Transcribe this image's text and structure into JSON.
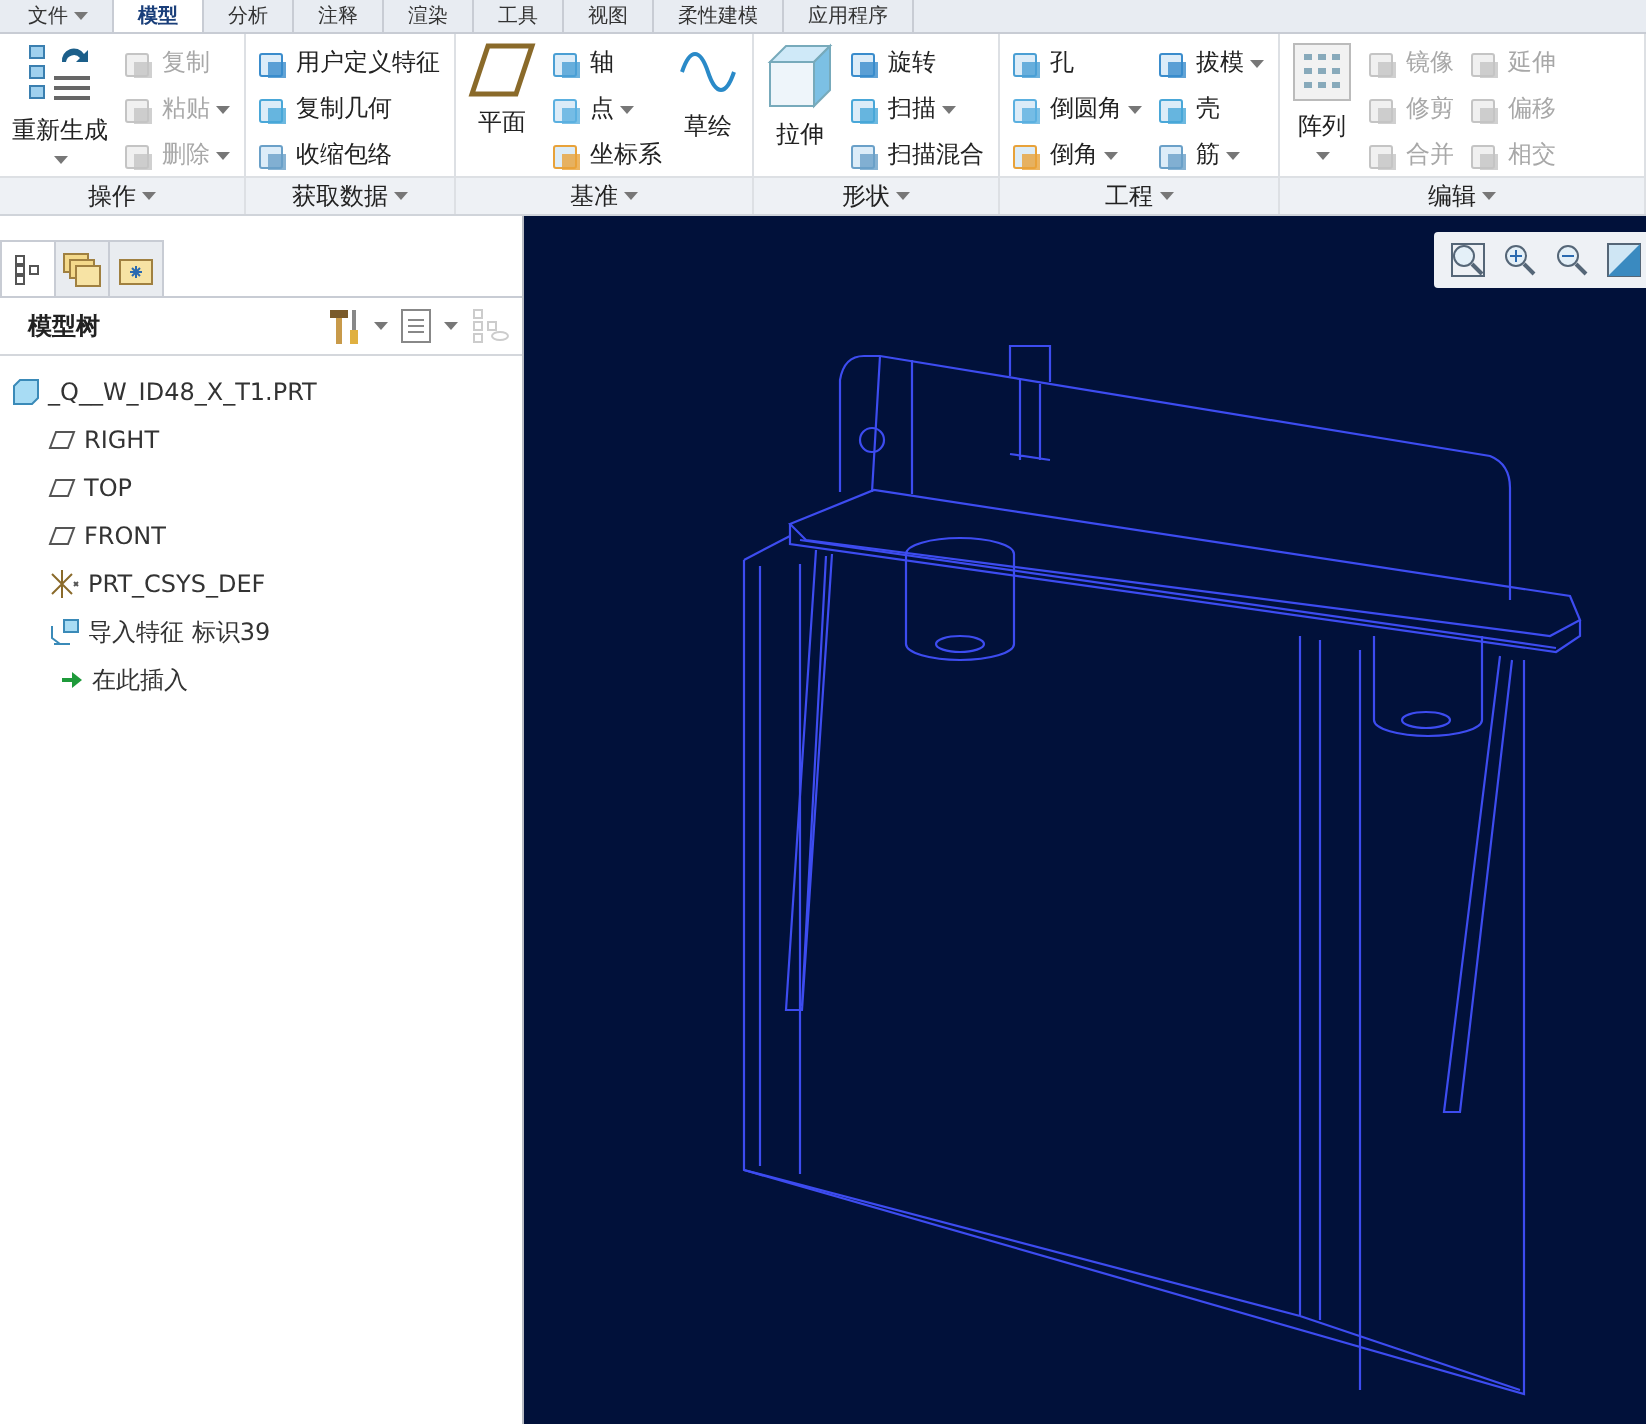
{
  "menu_tabs": [
    {
      "label": "文件",
      "dropdown": true,
      "selected": false
    },
    {
      "label": "模型",
      "dropdown": false,
      "selected": true
    },
    {
      "label": "分析",
      "dropdown": false,
      "selected": false
    },
    {
      "label": "注释",
      "dropdown": false,
      "selected": false
    },
    {
      "label": "渲染",
      "dropdown": false,
      "selected": false
    },
    {
      "label": "工具",
      "dropdown": false,
      "selected": false
    },
    {
      "label": "视图",
      "dropdown": false,
      "selected": false
    },
    {
      "label": "柔性建模",
      "dropdown": false,
      "selected": false
    },
    {
      "label": "应用程序",
      "dropdown": false,
      "selected": false
    }
  ],
  "ribbon": {
    "groups": [
      {
        "label": "操作",
        "columns": [
          [
            {
              "label": "重新生成",
              "kind": "large",
              "disabled": false,
              "dropdown": true
            }
          ],
          [
            {
              "label": "复制",
              "kind": "small",
              "disabled": true,
              "dropdown": false
            },
            {
              "label": "粘贴",
              "kind": "small",
              "disabled": true,
              "dropdown": true
            },
            {
              "label": "删除",
              "kind": "small",
              "disabled": true,
              "dropdown": true
            }
          ]
        ]
      },
      {
        "label": "获取数据",
        "columns": [
          [
            {
              "label": "用户定义特征",
              "kind": "small",
              "disabled": false,
              "dropdown": false
            },
            {
              "label": "复制几何",
              "kind": "small",
              "disabled": false,
              "dropdown": false
            },
            {
              "label": "收缩包络",
              "kind": "small",
              "disabled": false,
              "dropdown": false
            }
          ]
        ]
      },
      {
        "label": "基准",
        "columns": [
          [
            {
              "label": "平面",
              "kind": "large",
              "disabled": false,
              "dropdown": false
            }
          ],
          [
            {
              "label": "轴",
              "kind": "small",
              "disabled": false,
              "dropdown": false
            },
            {
              "label": "点",
              "kind": "small",
              "disabled": false,
              "dropdown": true
            },
            {
              "label": "坐标系",
              "kind": "small",
              "disabled": false,
              "dropdown": false
            }
          ],
          [
            {
              "label": "草绘",
              "kind": "large",
              "disabled": false,
              "dropdown": false
            }
          ]
        ]
      },
      {
        "label": "形状",
        "columns": [
          [
            {
              "label": "拉伸",
              "kind": "large",
              "disabled": false,
              "dropdown": false
            }
          ],
          [
            {
              "label": "旋转",
              "kind": "small",
              "disabled": false,
              "dropdown": false
            },
            {
              "label": "扫描",
              "kind": "small",
              "disabled": false,
              "dropdown": true
            },
            {
              "label": "扫描混合",
              "kind": "small",
              "disabled": false,
              "dropdown": false
            }
          ]
        ]
      },
      {
        "label": "工程",
        "columns": [
          [
            {
              "label": "孔",
              "kind": "small",
              "disabled": false,
              "dropdown": false
            },
            {
              "label": "倒圆角",
              "kind": "small",
              "disabled": false,
              "dropdown": true
            },
            {
              "label": "倒角",
              "kind": "small",
              "disabled": false,
              "dropdown": true
            }
          ],
          [
            {
              "label": "拔模",
              "kind": "small",
              "disabled": false,
              "dropdown": true
            },
            {
              "label": "壳",
              "kind": "small",
              "disabled": false,
              "dropdown": false
            },
            {
              "label": "筋",
              "kind": "small",
              "disabled": false,
              "dropdown": true
            }
          ]
        ]
      },
      {
        "label": "编辑",
        "columns": [
          [
            {
              "label": "阵列",
              "kind": "large",
              "disabled": false,
              "dropdown": true
            }
          ],
          [
            {
              "label": "镜像",
              "kind": "small",
              "disabled": true,
              "dropdown": false
            },
            {
              "label": "修剪",
              "kind": "small",
              "disabled": true,
              "dropdown": false
            },
            {
              "label": "合并",
              "kind": "small",
              "disabled": true,
              "dropdown": false
            }
          ],
          [
            {
              "label": "延伸",
              "kind": "small",
              "disabled": true,
              "dropdown": false
            },
            {
              "label": "偏移",
              "kind": "small",
              "disabled": true,
              "dropdown": false
            },
            {
              "label": "相交",
              "kind": "small",
              "disabled": true,
              "dropdown": false
            }
          ]
        ]
      }
    ]
  },
  "navigator": {
    "tabs": [
      {
        "selected": true
      },
      {
        "selected": false
      },
      {
        "selected": false
      }
    ],
    "title": "模型树",
    "tree": [
      {
        "label": "_Q__W_ID48_X_T1.PRT",
        "kind": "part",
        "children": [
          {
            "label": "RIGHT",
            "kind": "plane"
          },
          {
            "label": "TOP",
            "kind": "plane"
          },
          {
            "label": "FRONT",
            "kind": "plane"
          },
          {
            "label": "PRT_CSYS_DEF",
            "kind": "csys"
          },
          {
            "label": "导入特征 标识39",
            "kind": "import"
          },
          {
            "label": "在此插入",
            "kind": "insert"
          }
        ]
      }
    ]
  }
}
